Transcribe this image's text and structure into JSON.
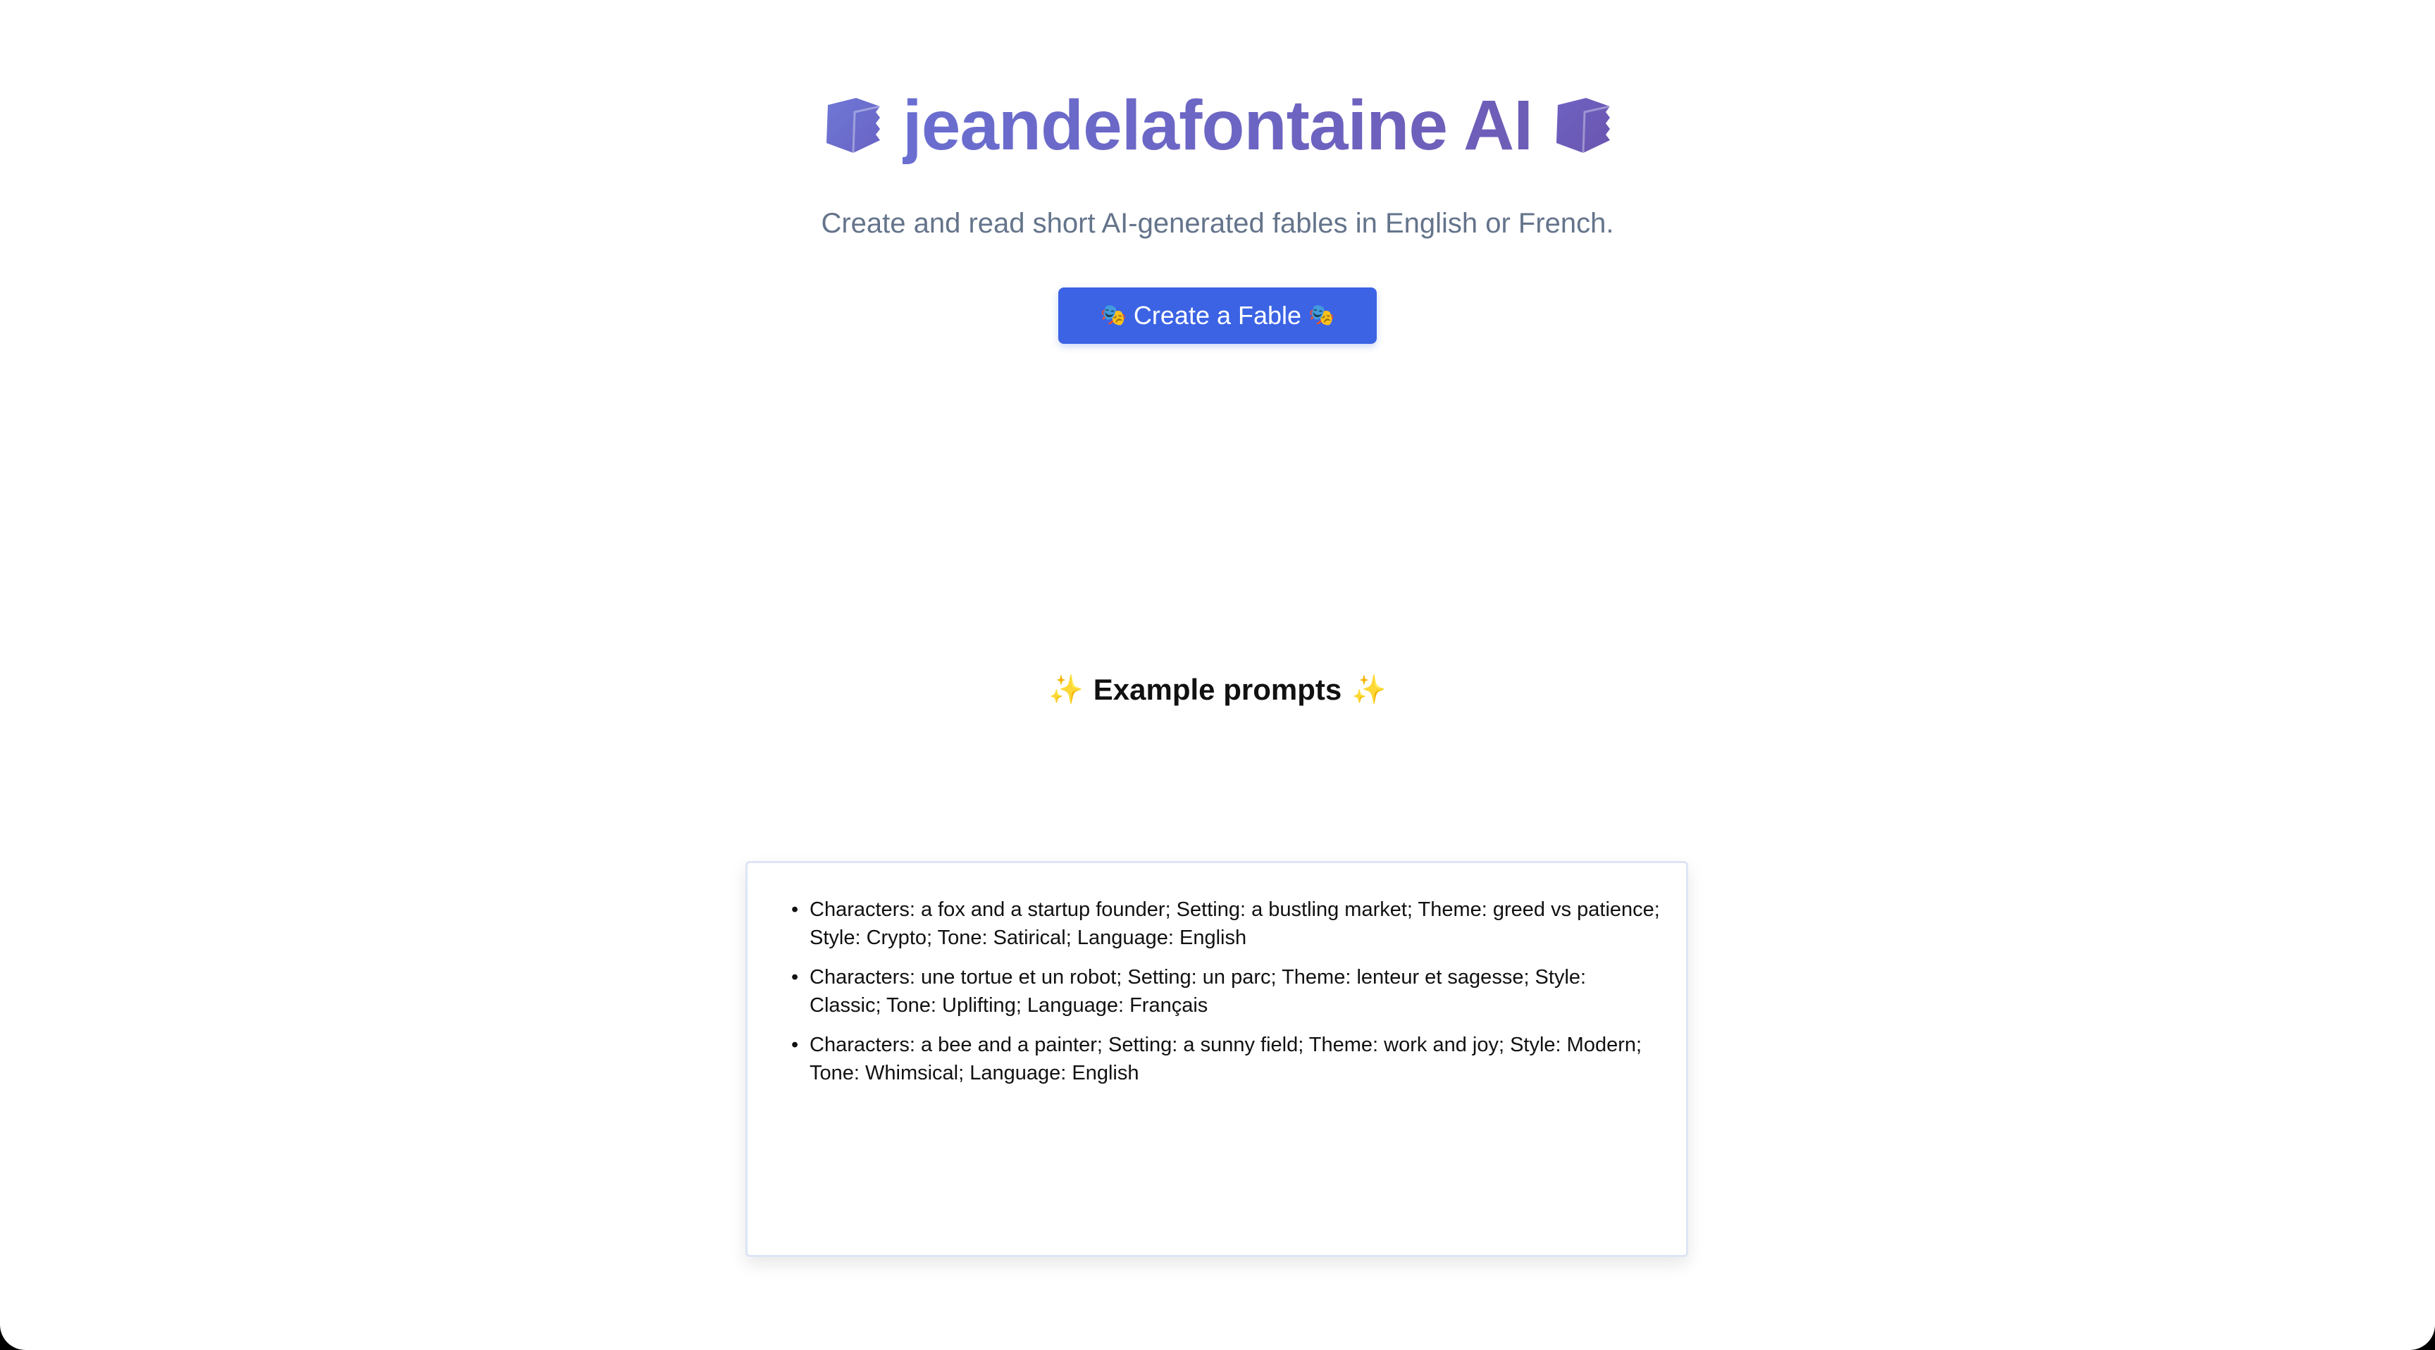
{
  "app": {
    "title": "jeandelafontaine AI",
    "subtitle": "Create and read short AI-generated fables in English or French."
  },
  "header": {
    "left_icon": "closed-book-icon",
    "right_icon": "closed-book-icon"
  },
  "create_button": {
    "label": "Create a Fable",
    "left_icon": "theater-masks-icon",
    "right_icon": "theater-masks-icon",
    "left_glyph": "🎭",
    "right_glyph": "🎭"
  },
  "examples": {
    "heading": "Example prompts",
    "left_icon": "sparkles-icon",
    "right_icon": "sparkles-icon",
    "left_glyph": "✨",
    "right_glyph": "✨",
    "items": [
      "Characters: a fox and a startup founder; Setting: a bustling market; Theme: greed vs patience; Style: Crypto; Tone: Satirical; Language: English",
      "Characters: une tortue et un robot; Setting: un parc; Theme: lenteur et sagesse; Style: Classic; Tone: Uplifting; Language: Français",
      "Characters: a bee and a painter; Setting: a sunny field; Theme: work and joy; Style: Modern; Tone: Whimsical; Language: English"
    ]
  },
  "colors": {
    "title_gradient_start": "#6A6ED0",
    "title_gradient_end": "#6E5DB7",
    "button_bg": "#3B63E4",
    "subtitle": "#64748B",
    "sparkle": "#F2C94C"
  }
}
